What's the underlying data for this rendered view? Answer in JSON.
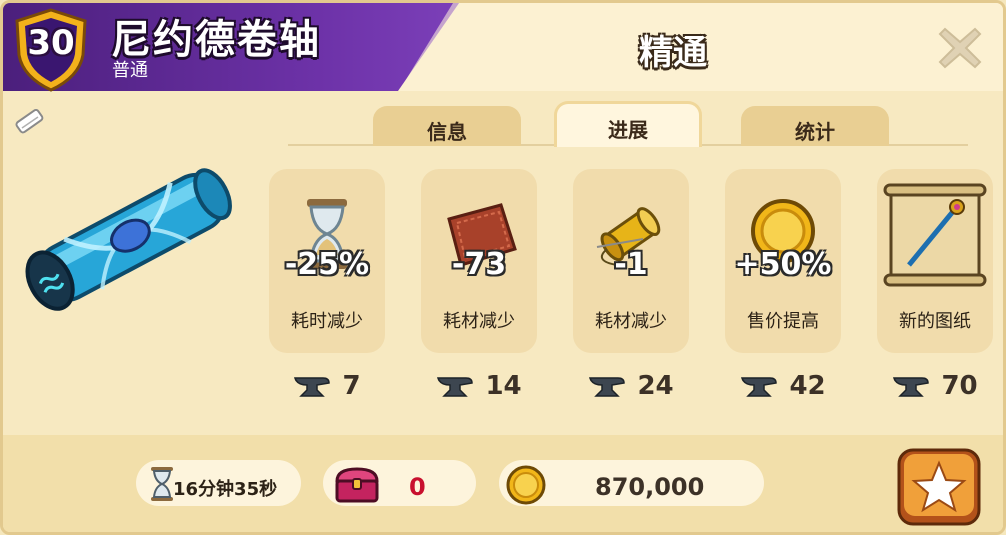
{
  "header": {
    "level": "30",
    "title": "尼约德卷轴",
    "subtitle": "普通",
    "section_title": "精通"
  },
  "tabs": [
    {
      "label": "信息",
      "active": false
    },
    {
      "label": "进展",
      "active": true
    },
    {
      "label": "统计",
      "active": false
    }
  ],
  "milestones": [
    {
      "value": "-25%",
      "label": "耗时减少",
      "icon": "hourglass-icon",
      "cost": "7"
    },
    {
      "value": "-73",
      "label": "耗材减少",
      "icon": "leather-icon",
      "cost": "14"
    },
    {
      "value": "-1",
      "label": "耗材减少",
      "icon": "thread-spool-icon",
      "cost": "24"
    },
    {
      "value": "+50%",
      "label": "售价提高",
      "icon": "gold-coin-icon",
      "cost": "42"
    },
    {
      "value": "",
      "label": "新的图纸",
      "icon": "blueprint-scroll-icon",
      "cost": "70"
    }
  ],
  "bottom": {
    "time": "16分钟35秒",
    "chest_count": "0",
    "gold": "870,000"
  },
  "colors": {
    "header_purple": "#5a2691",
    "panel_bg": "#f7e9c1",
    "card_bg": "#f1dcac",
    "star_button": "#e98a2a",
    "chest_count": "#c8102e"
  }
}
